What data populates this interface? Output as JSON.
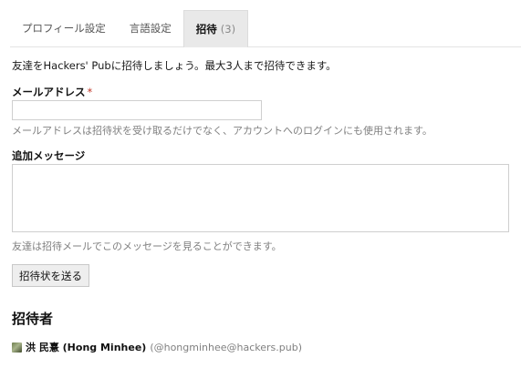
{
  "tabs": [
    {
      "label": "プロフィール設定",
      "active": false
    },
    {
      "label": "言語設定",
      "active": false
    },
    {
      "label": "招待",
      "count": "(3)",
      "active": true
    }
  ],
  "intro_text": "友達をHackers' Pubに招待しましょう。最大3人まで招待できます。",
  "email": {
    "label": "メールアドレス",
    "required_mark": "*",
    "value": "",
    "help": "メールアドレスは招待状を受け取るだけでなく、アカウントへのログインにも使用されます。"
  },
  "message": {
    "label": "追加メッセージ",
    "value": "",
    "help": "友達は招待メールでこのメッセージを見ることができます。"
  },
  "send_button_label": "招待状を送る",
  "inviter": {
    "heading": "招待者",
    "name": "洪 民憙 (Hong Minhee)",
    "handle": "(@hongminhee@hackers.pub)",
    "avatar_icon": "user-avatar"
  },
  "colors": {
    "required": "#c0392b",
    "help_text": "#808080",
    "active_tab_bg": "#e9e9e9"
  }
}
